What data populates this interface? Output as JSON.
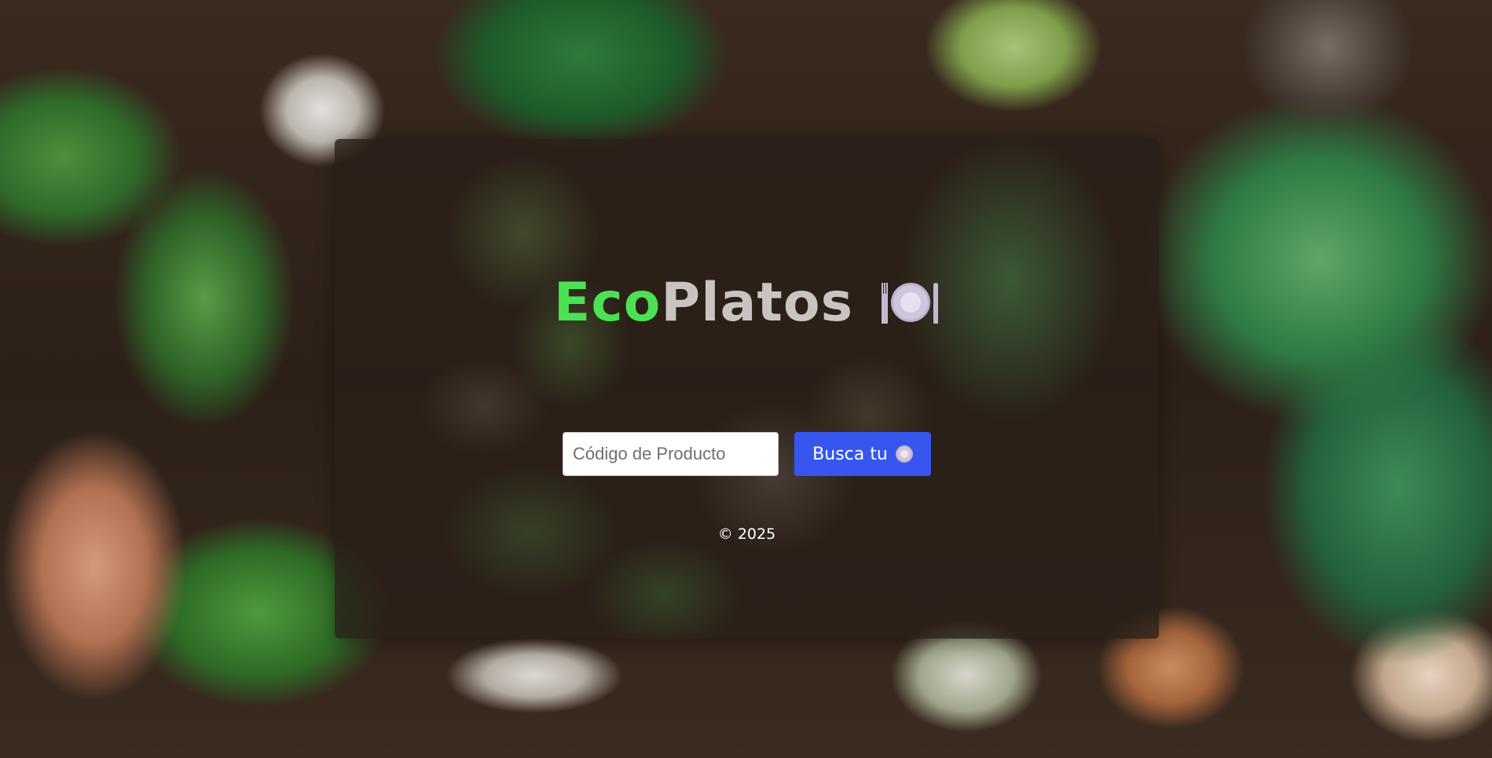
{
  "brand": {
    "part1": "Eco",
    "part2": "Platos",
    "icon": "plate-with-cutlery-icon",
    "colors": {
      "eco": "#4ce055",
      "platos": "#c9c3c2"
    }
  },
  "search": {
    "placeholder": "Código de Producto",
    "value": "",
    "button_label": "Busca tu",
    "button_icon": "plate-with-cutlery-icon",
    "button_color": "#3656ef"
  },
  "footer": {
    "text": "© 2025"
  }
}
